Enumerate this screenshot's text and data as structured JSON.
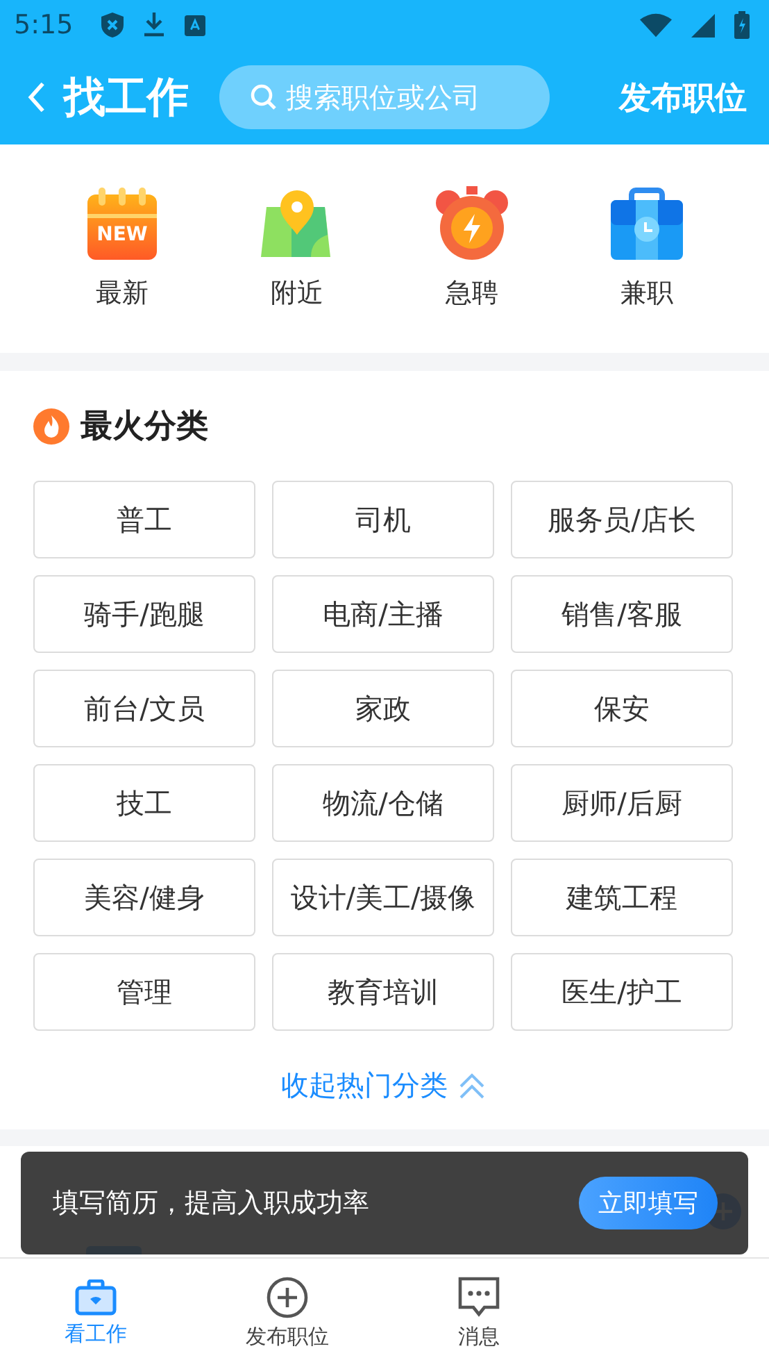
{
  "status_bar": {
    "time": "5:15"
  },
  "header": {
    "title": "找工作",
    "search": {
      "placeholder": "搜索职位或公司"
    },
    "action": "发布职位"
  },
  "quick_links": [
    {
      "kind": "calendar",
      "label": "最新",
      "badge": "NEW"
    },
    {
      "kind": "map",
      "label": "附近"
    },
    {
      "kind": "alarm",
      "label": "急聘"
    },
    {
      "kind": "briefcase",
      "label": "兼职"
    }
  ],
  "hot_categories": {
    "title": "最火分类",
    "items": [
      "普工",
      "司机",
      "服务员/店长",
      "骑手/跑腿",
      "电商/主播",
      "销售/客服",
      "前台/文员",
      "家政",
      "保安",
      "技工",
      "物流/仓储",
      "厨师/后厨",
      "美容/健身",
      "设计/美工/摄像",
      "建筑工程",
      "管理",
      "教育培训",
      "医生/护工"
    ],
    "collapse": "收起热门分类"
  },
  "toast": {
    "text": "填写简历，提高入职成功率",
    "button": "立即填写"
  },
  "bottom_nav": [
    {
      "kind": "briefcase",
      "label": "看工作",
      "selected": true
    },
    {
      "kind": "plus",
      "label": "发布职位",
      "selected": false
    },
    {
      "kind": "message",
      "label": "消息",
      "selected": false
    }
  ]
}
